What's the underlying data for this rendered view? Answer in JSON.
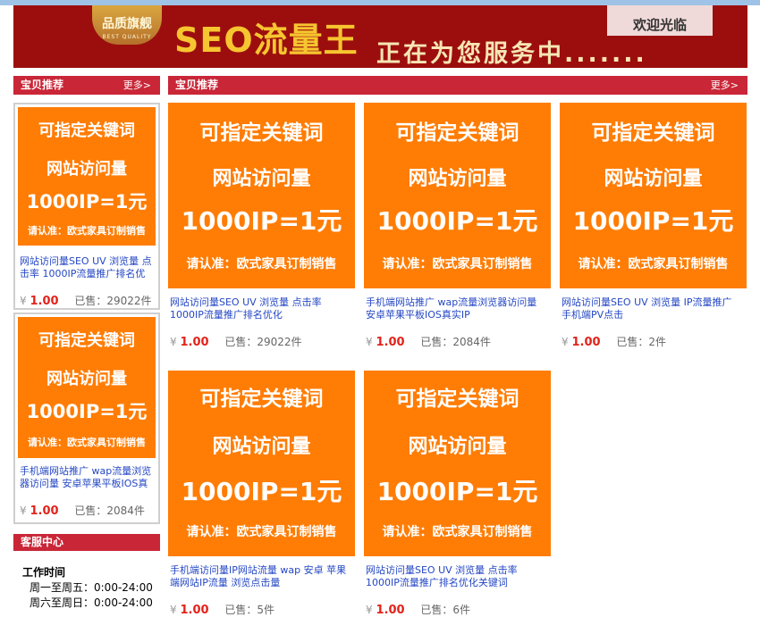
{
  "banner": {
    "badge_main": "品质旗舰",
    "badge_sub": "BEST QUALITY",
    "title": "SEO流量王",
    "subtitle": "正在为您服务中.......",
    "welcome": "欢迎光临"
  },
  "sidebar": {
    "header": "宝贝推荐",
    "more": "更多>",
    "items": [
      {
        "promo": [
          "可指定关键词",
          "网站访问量",
          "1000IP=1元",
          "请认准：欧式家具订制销售"
        ],
        "title": "网站访问量SEO UV 浏览量 点击率 1000IP流量推广排名优",
        "currency": "¥",
        "price": "1.00",
        "sold": "已售：29022件"
      },
      {
        "promo": [
          "可指定关键词",
          "网站访问量",
          "1000IP=1元",
          "请认准：欧式家具订制销售"
        ],
        "title": "手机端网站推广 wap流量浏览器访问量 安卓苹果平板IOS真",
        "currency": "¥",
        "price": "1.00",
        "sold": "已售：2084件"
      }
    ],
    "service": {
      "header": "客服中心",
      "hours_title": "工作时间",
      "weekday": "周一至周五：0:00-24:00",
      "weekend": "周六至周日：0:00-24:00"
    }
  },
  "main": {
    "header": "宝贝推荐",
    "more": "更多>",
    "products": [
      {
        "promo": [
          "可指定关键词",
          "网站访问量",
          "1000IP=1元",
          "请认准：欧式家具订制销售"
        ],
        "title": "网站访问量SEO UV 浏览量 点击率 1000IP流量推广排名优化",
        "currency": "¥",
        "price": "1.00",
        "sold": "已售：29022件"
      },
      {
        "promo": [
          "可指定关键词",
          "网站访问量",
          "1000IP=1元",
          "请认准：欧式家具订制销售"
        ],
        "title": "手机端网站推广 wap流量浏览器访问量 安卓苹果平板IOS真实IP",
        "currency": "¥",
        "price": "1.00",
        "sold": "已售：2084件"
      },
      {
        "promo": [
          "可指定关键词",
          "网站访问量",
          "1000IP=1元",
          "请认准：欧式家具订制销售"
        ],
        "title": "网站访问量SEO UV 浏览量 IP流量推广 手机端PV点击",
        "currency": "¥",
        "price": "1.00",
        "sold": "已售：2件"
      },
      {
        "promo": [
          "可指定关键词",
          "网站访问量",
          "1000IP=1元",
          "请认准：欧式家具订制销售"
        ],
        "title": "手机端访问量IP网站流量 wap 安卓 苹果端网站IP流量 浏览点击量",
        "currency": "¥",
        "price": "1.00",
        "sold": "已售：5件"
      },
      {
        "promo": [
          "可指定关键词",
          "网站访问量",
          "1000IP=1元",
          "请认准：欧式家具订制销售"
        ],
        "title": "网站访问量SEO UV 浏览量 点击率 1000IP流量推广排名优化关键词",
        "currency": "¥",
        "price": "1.00",
        "sold": "已售：6件"
      }
    ]
  }
}
